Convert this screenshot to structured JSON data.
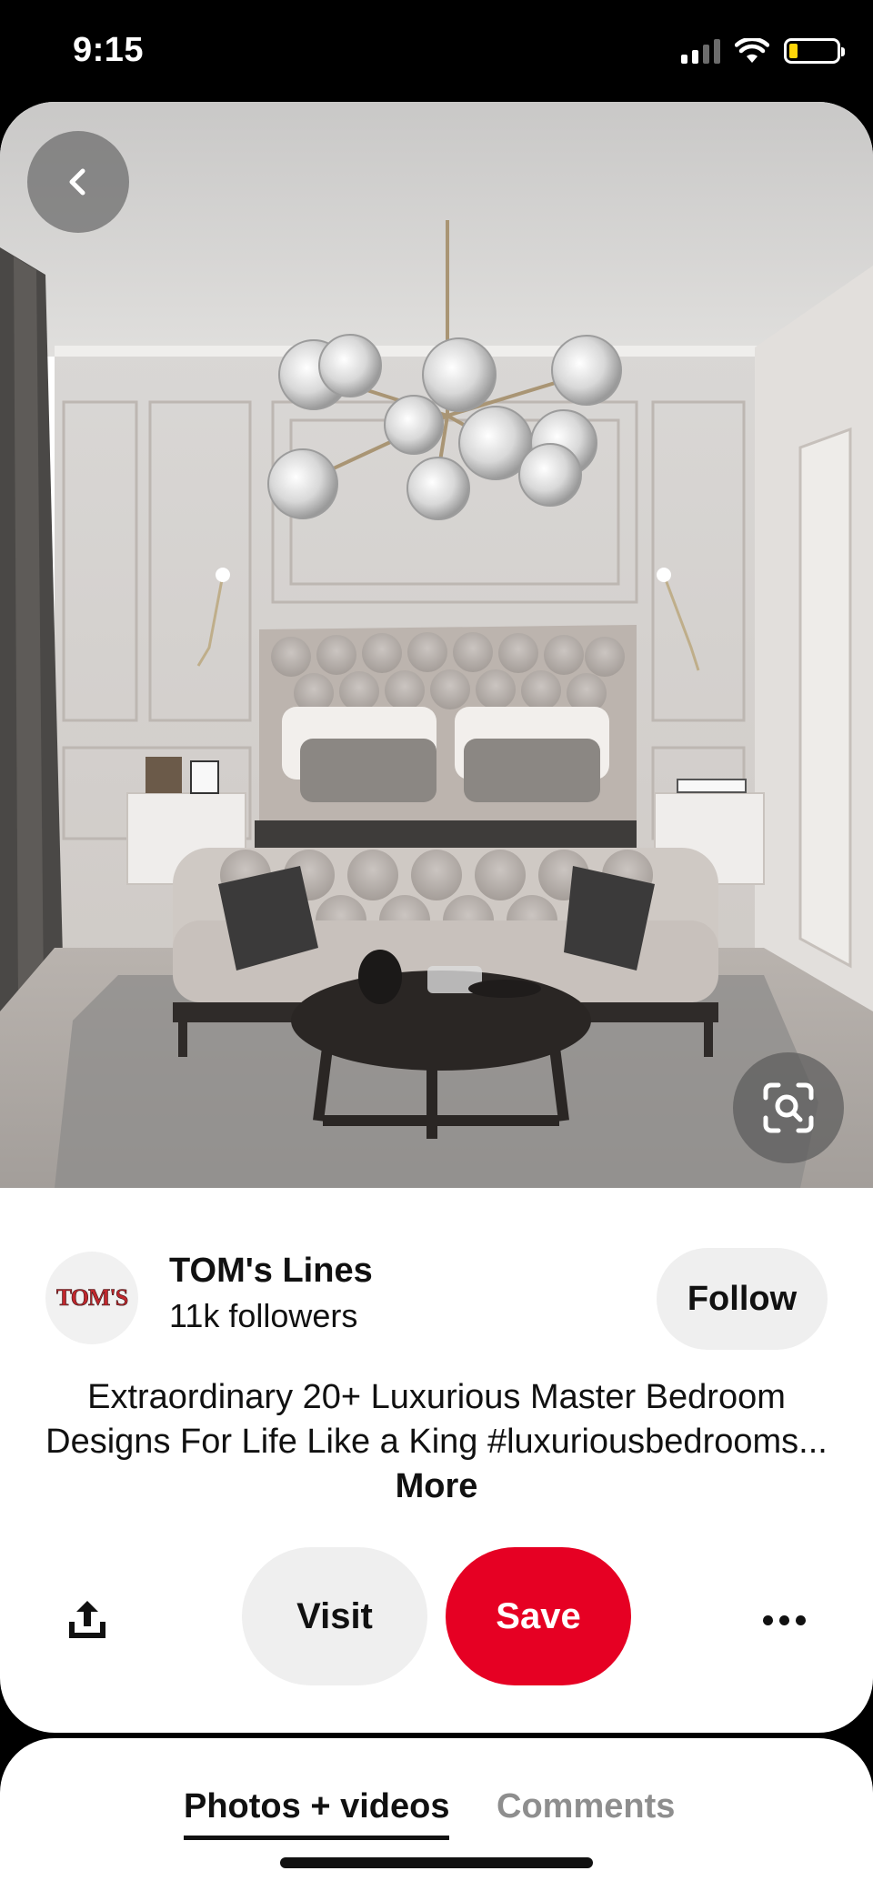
{
  "status_bar": {
    "time": "9:15",
    "signal_icon": "cellular-signal-icon",
    "wifi_icon": "wifi-icon",
    "battery_icon": "battery-low-icon",
    "battery_color": "#ffd60a"
  },
  "pin": {
    "image_icon_back": "chevron-left-icon",
    "image_icon_lens": "visual-search-icon"
  },
  "creator": {
    "avatar_text": "TOM'S",
    "name": "TOM's Lines",
    "followers": "11k followers",
    "follow_label": "Follow"
  },
  "description": {
    "text": "Extraordinary 20+ Luxurious Master Bedroom Designs For Life Like a King #luxuriousbedrooms...",
    "more_label": "More"
  },
  "actions": {
    "share_icon": "share-upload-icon",
    "visit_label": "Visit",
    "save_label": "Save",
    "save_color": "#e60023",
    "more_icon": "more-horizontal-icon"
  },
  "tabs": {
    "photos_label": "Photos + videos",
    "comments_label": "Comments",
    "active": "Photos + videos"
  }
}
